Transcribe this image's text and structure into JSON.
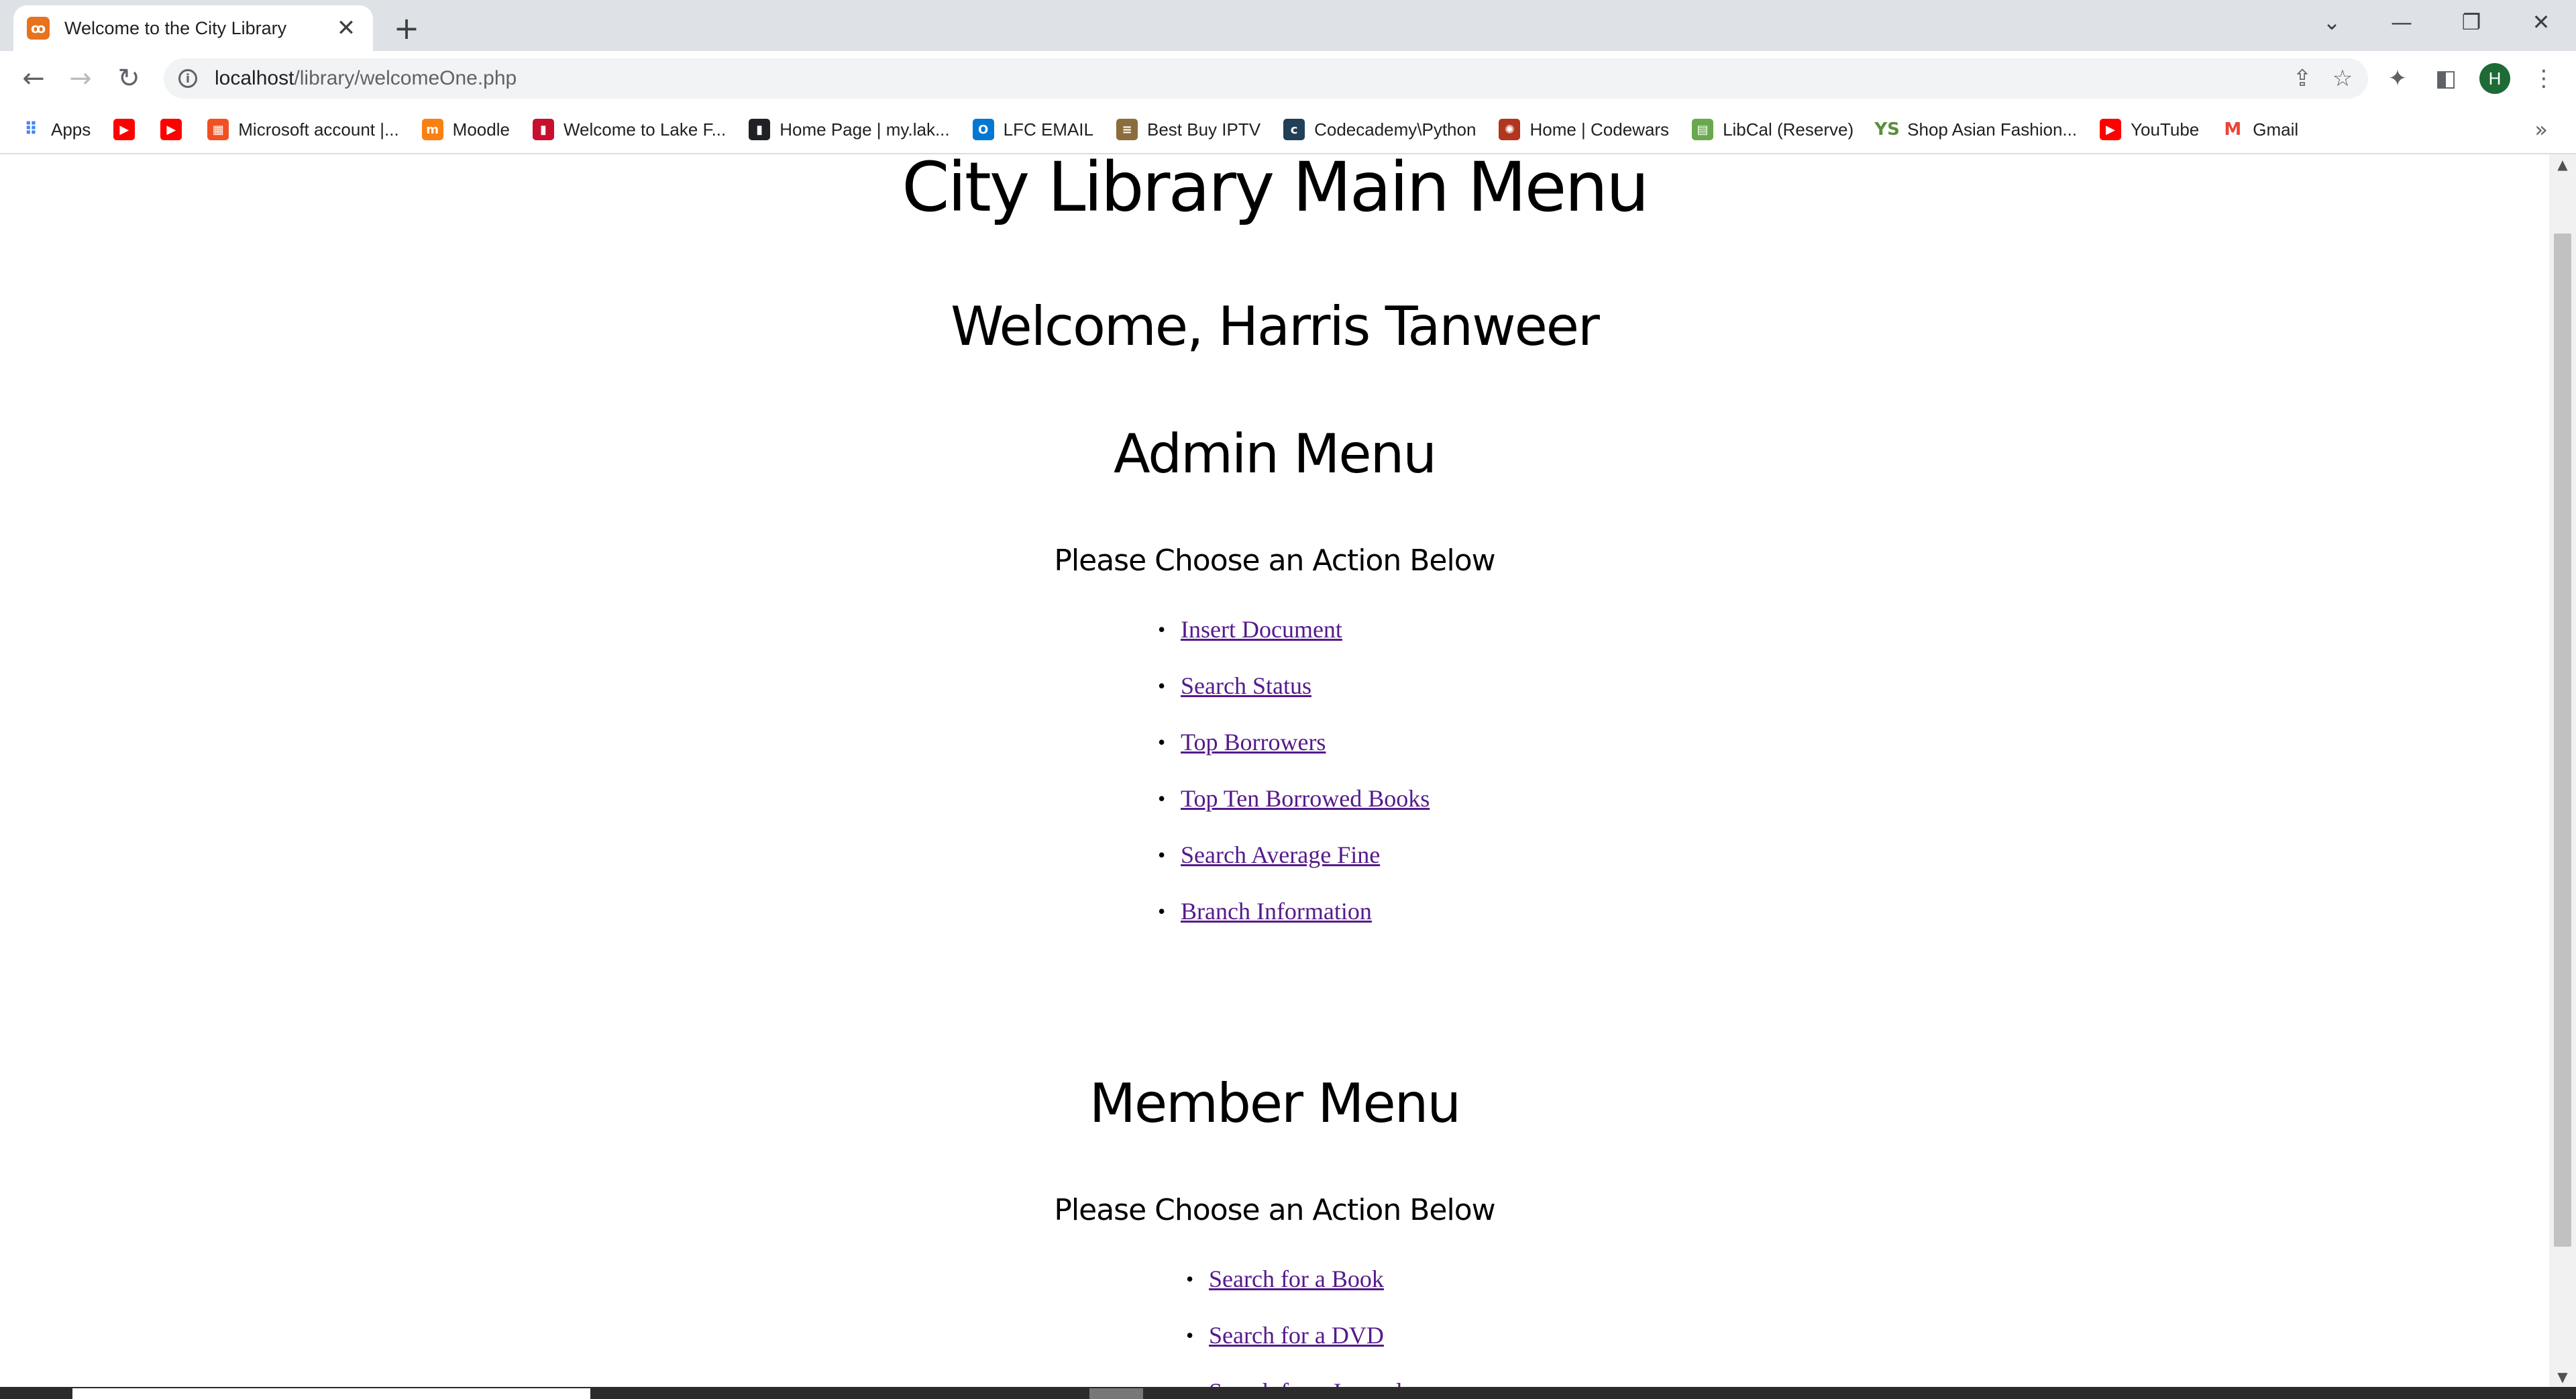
{
  "browser": {
    "tab": {
      "title": "Welcome to the City Library",
      "favicon": "xampp-icon"
    },
    "url": {
      "host": "localhost",
      "path": "/library/welcomeOne.php"
    },
    "profile_initial": "H",
    "bookmarks": [
      {
        "label": "Apps",
        "icon": "apps-grid-icon",
        "color": "#4285f4"
      },
      {
        "label": "",
        "icon": "youtube-icon",
        "color": "#ff0000"
      },
      {
        "label": "",
        "icon": "youtube-icon",
        "color": "#ff0000"
      },
      {
        "label": "Microsoft account |...",
        "icon": "microsoft-icon",
        "color": "#f25022"
      },
      {
        "label": "Moodle",
        "icon": "moodle-icon",
        "color": "#f98012"
      },
      {
        "label": "Welcome to Lake F...",
        "icon": "book-icon",
        "color": "#c8102e"
      },
      {
        "label": "Home Page | my.lak...",
        "icon": "book-icon",
        "color": "#202124"
      },
      {
        "label": "LFC EMAIL",
        "icon": "outlook-icon",
        "color": "#0078d4"
      },
      {
        "label": "Best Buy IPTV",
        "icon": "document-icon",
        "color": "#8a6d3b"
      },
      {
        "label": "Codecademy\\Python",
        "icon": "codecademy-icon",
        "color": "#1f4056"
      },
      {
        "label": "Home | Codewars",
        "icon": "codewars-icon",
        "color": "#b1361e"
      },
      {
        "label": "LibCal (Reserve)",
        "icon": "libcal-icon",
        "color": "#6aa84f"
      },
      {
        "label": "Shop Asian Fashion...",
        "icon": "ys-icon",
        "color": "#5a8f3c"
      },
      {
        "label": "YouTube",
        "icon": "youtube-icon",
        "color": "#ff0000"
      },
      {
        "label": "Gmail",
        "icon": "gmail-icon",
        "color": "#ea4335"
      }
    ]
  },
  "page": {
    "title": "City Library Main Menu",
    "welcome": "Welcome, Harris Tanweer",
    "admin": {
      "heading": "Admin Menu",
      "prompt": "Please Choose an Action Below",
      "links": [
        "Insert Document",
        "Search Status",
        "Top Borrowers",
        "Top Ten Borrowed Books",
        "Search Average Fine",
        "Branch Information"
      ]
    },
    "member": {
      "heading": "Member Menu",
      "prompt": "Please Choose an Action Below",
      "links": [
        "Search for a Book",
        "Search for a DVD",
        "Search for a Journal"
      ]
    }
  },
  "colors": {
    "visited_link": "#551a8b",
    "tabstrip": "#dee1e6",
    "avatar": "#1e6b35"
  }
}
